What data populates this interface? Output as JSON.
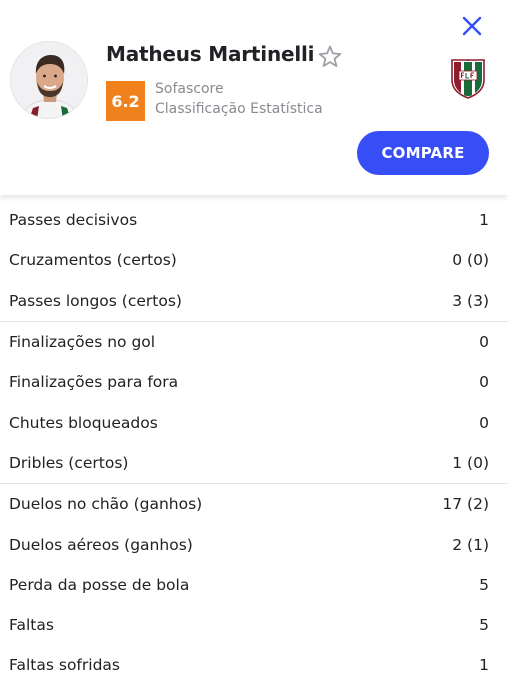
{
  "player": {
    "name": "Matheus Martinelli",
    "rating": "6.2",
    "rating_source": "Sofascore",
    "rating_label": "Classificação Estatística"
  },
  "actions": {
    "compare_label": "COMPARE"
  },
  "colors": {
    "rating_badge": "#f0821e",
    "compare_button": "#374df5",
    "close_icon": "#374df5",
    "club_maroon": "#8b1d2c",
    "club_green": "#1a6b3a"
  },
  "icons": {
    "close": "close-icon",
    "favorite": "star-outline-icon",
    "club": "fluminense-crest-icon",
    "avatar": "player-photo"
  },
  "stat_groups": [
    [
      {
        "label": "Passes decisivos",
        "value": "1"
      },
      {
        "label": "Cruzamentos (certos)",
        "value": "0 (0)"
      },
      {
        "label": "Passes longos (certos)",
        "value": "3 (3)"
      }
    ],
    [
      {
        "label": "Finalizações no gol",
        "value": "0"
      },
      {
        "label": "Finalizações para fora",
        "value": "0"
      },
      {
        "label": "Chutes bloqueados",
        "value": "0"
      },
      {
        "label": "Dribles (certos)",
        "value": "1 (0)"
      }
    ],
    [
      {
        "label": "Duelos no chão (ganhos)",
        "value": "17 (2)"
      },
      {
        "label": "Duelos aéreos (ganhos)",
        "value": "2 (1)"
      },
      {
        "label": "Perda da posse de bola",
        "value": "5"
      },
      {
        "label": "Faltas",
        "value": "5"
      },
      {
        "label": "Faltas sofridas",
        "value": "1"
      }
    ]
  ]
}
